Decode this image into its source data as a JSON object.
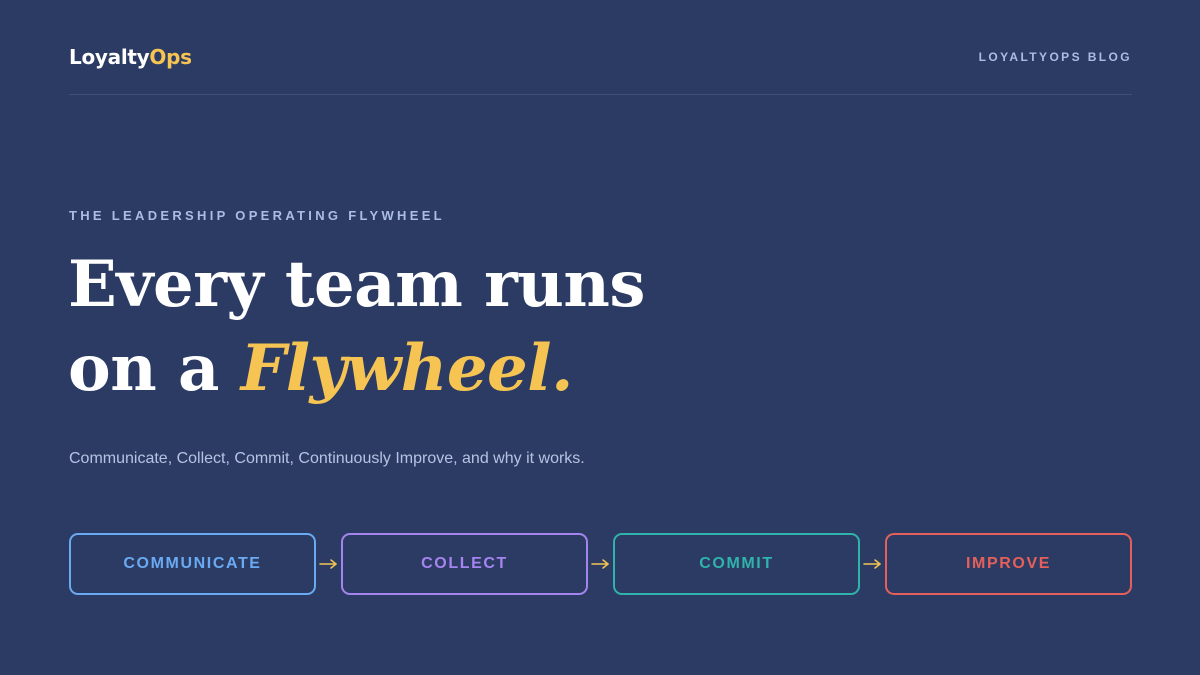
{
  "header": {
    "logo_main": "Loyalty",
    "logo_accent": "Ops",
    "blog_link": "LOYALTYOPS BLOG"
  },
  "hero": {
    "eyebrow": "THE LEADERSHIP OPERATING FLYWHEEL",
    "headline_line1": "Every team runs",
    "headline_line2_prefix": "on a ",
    "headline_highlight": "Flywheel.",
    "subtitle": "Communicate, Collect, Commit, Continuously Improve, and why it works."
  },
  "steps": [
    {
      "label": "COMMUNICATE",
      "color": "#6aaaf2"
    },
    {
      "label": "COLLECT",
      "color": "#a684f0"
    },
    {
      "label": "COMMIT",
      "color": "#2fb3aa"
    },
    {
      "label": "IMPROVE",
      "color": "#e5605a"
    }
  ],
  "colors": {
    "background": "#2c3b64",
    "accent": "#f6c453",
    "muted_text": "#a9bde6",
    "arrow": "#f6c453"
  },
  "icons": {
    "arrow": "arrow-right-icon"
  }
}
